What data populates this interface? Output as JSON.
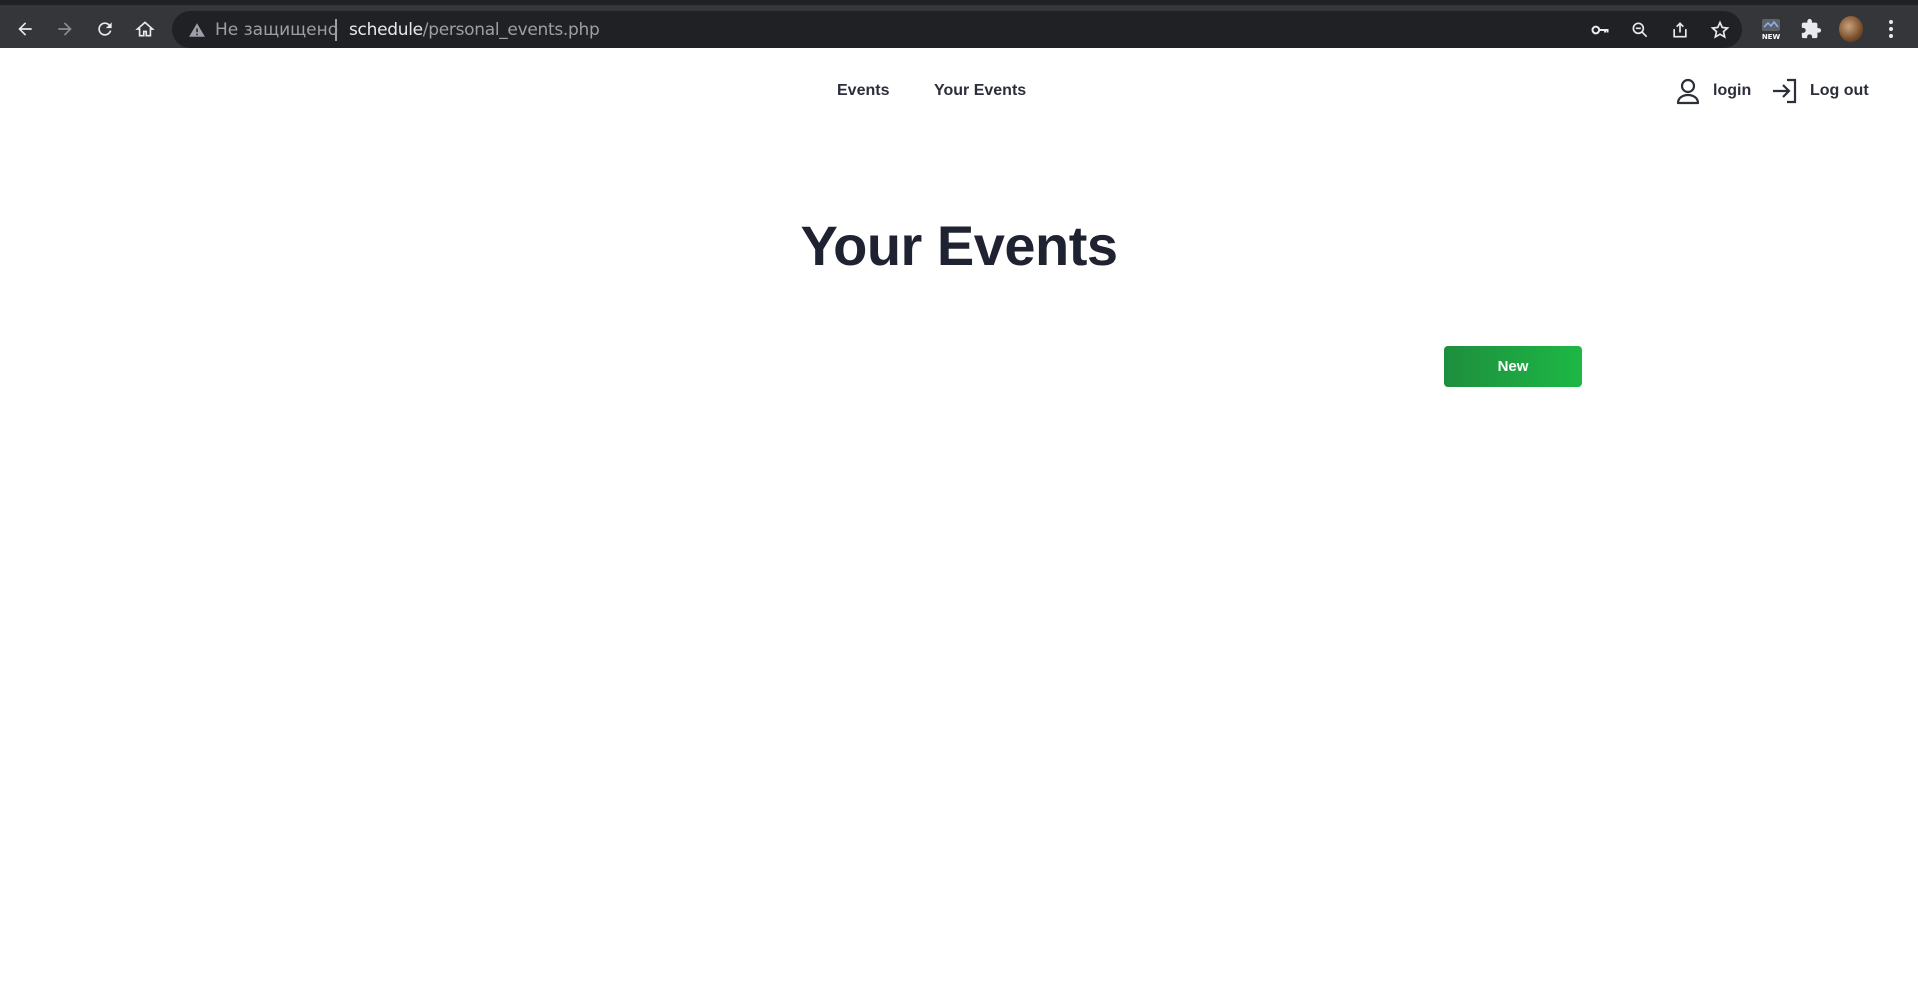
{
  "browser": {
    "security_label": "Не защищено",
    "url_host": "schedule",
    "url_path": "/personal_events.php",
    "icons": [
      "back-arrow-icon",
      "forward-arrow-icon",
      "reload-icon",
      "home-icon",
      "warning-icon",
      "key-icon",
      "zoom-out-icon",
      "share-icon",
      "star-icon",
      "extension-new-icon",
      "puzzle-icon",
      "profile-avatar",
      "kebab-menu-icon"
    ],
    "extension_badge": "NEW"
  },
  "nav": {
    "items": [
      {
        "label": "Events"
      },
      {
        "label": "Your Events"
      }
    ],
    "login_label": "login",
    "logout_label": "Log out"
  },
  "main": {
    "title": "Your Events",
    "new_button_label": "New"
  },
  "colors": {
    "accent_green": "#1db845",
    "text_dark": "#1f2230",
    "chrome_bg": "#35363a"
  }
}
